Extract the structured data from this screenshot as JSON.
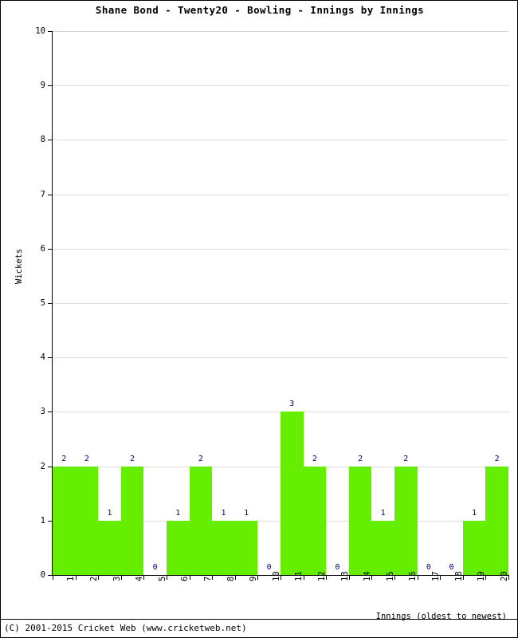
{
  "chart_data": {
    "type": "bar",
    "title": "Shane Bond - Twenty20 - Bowling - Innings by Innings",
    "xlabel": "Innings (oldest to newest)",
    "ylabel": "Wickets",
    "categories": [
      "1",
      "2",
      "3",
      "4",
      "5",
      "6",
      "7",
      "8",
      "9",
      "10",
      "11",
      "12",
      "13",
      "14",
      "15",
      "16",
      "17",
      "18",
      "19",
      "20"
    ],
    "values": [
      2,
      2,
      1,
      2,
      0,
      1,
      2,
      1,
      1,
      0,
      3,
      2,
      0,
      2,
      1,
      2,
      0,
      0,
      1,
      2
    ],
    "data_labels": [
      "2",
      "2",
      "1",
      "2",
      "0",
      "1",
      "2",
      "1",
      "1",
      "0",
      "3",
      "2",
      "0",
      "2",
      "1",
      "2",
      "0",
      "0",
      "1",
      "2"
    ],
    "ylim": [
      0,
      10
    ],
    "y_ticks": [
      "0",
      "1",
      "2",
      "3",
      "4",
      "5",
      "6",
      "7",
      "8",
      "9",
      "10"
    ],
    "grid": true,
    "legend": false,
    "bar_color": "#66ee00",
    "label_color": "#000080",
    "gridline_color": "#dcdcdc",
    "axis_color": "#000000"
  },
  "footer": {
    "copyright": "(C) 2001-2015 Cricket Web (www.cricketweb.net)"
  }
}
